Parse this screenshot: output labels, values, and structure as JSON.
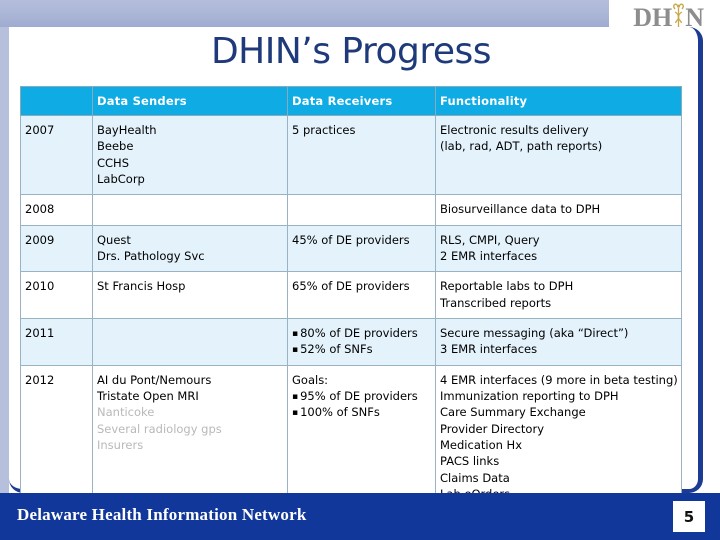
{
  "slide": {
    "title": "DHIN’s Progress",
    "logo": {
      "left_text": "DH",
      "right_text": "N",
      "icon_name": "caduceus-icon"
    }
  },
  "table": {
    "columns": [
      "",
      "Data Senders",
      "Data Receivers",
      "Functionality"
    ],
    "rows": [
      {
        "year": "2007",
        "senders": [
          "BayHealth",
          "Beebe",
          "CCHS",
          "LabCorp"
        ],
        "receivers": [
          "5 practices"
        ],
        "functionality": [
          "Electronic results delivery",
          "(lab, rad, ADT, path reports)"
        ]
      },
      {
        "year": "2008",
        "senders": [],
        "receivers": [],
        "functionality": [
          "Biosurveillance data to DPH"
        ]
      },
      {
        "year": "2009",
        "senders": [
          "Quest",
          "Drs. Pathology Svc"
        ],
        "receivers": [
          "45% of DE providers"
        ],
        "functionality": [
          "RLS, CMPI, Query",
          "2 EMR interfaces"
        ]
      },
      {
        "year": "2010",
        "senders": [
          "St Francis Hosp"
        ],
        "receivers": [
          "65% of DE providers"
        ],
        "functionality": [
          "Reportable labs to DPH",
          "Transcribed reports"
        ]
      },
      {
        "year": "2011",
        "senders": [],
        "receivers": [
          "80% of DE providers",
          "52% of SNFs"
        ],
        "functionality": [
          "Secure messaging (aka “Direct”)",
          "3 EMR interfaces"
        ]
      },
      {
        "year": "2012",
        "senders": [
          "AI du Pont/Nemours",
          "Tristate Open MRI",
          "Nanticoke",
          "Several radiology gps",
          "Insurers"
        ],
        "receivers_heading": "Goals:",
        "receivers": [
          "95% of DE providers",
          "100% of SNFs"
        ],
        "functionality": [
          "4 EMR interfaces (9 more in beta testing)",
          "Immunization reporting to DPH",
          "Care Summary Exchange",
          "Provider Directory",
          "Medication Hx",
          "PACS links",
          "Claims Data",
          "Lab eOrders"
        ]
      }
    ]
  },
  "footer": {
    "organization": "Delaware Health Information Network",
    "page_number": "5"
  },
  "colors": {
    "header_row": "#0FABE4",
    "alt_row": "#E3F2FB",
    "footer_bar": "#12379A",
    "title_text": "#1F3A7A",
    "top_band": "#AAB5D6",
    "muted_text": "#B9B9B9"
  }
}
